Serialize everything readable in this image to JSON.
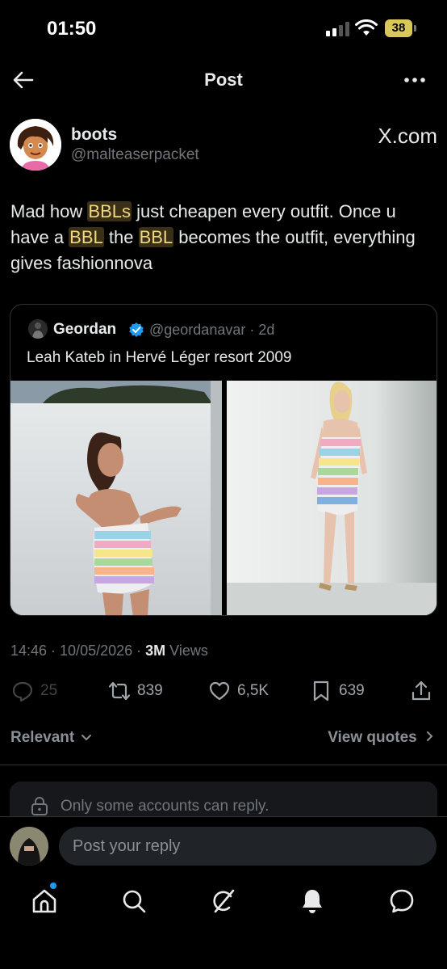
{
  "status": {
    "time": "01:50",
    "battery": "38"
  },
  "nav": {
    "title": "Post"
  },
  "author": {
    "name": "boots",
    "handle": "@malteaserpacket",
    "source": "X.com"
  },
  "tweet": {
    "p1": "Mad how ",
    "h1": "BBLs",
    "p2": " just cheapen every outfit. Once u have a ",
    "h2": "BBL",
    "p3": " the ",
    "h3": "BBL",
    "p4": " becomes the outfit, everything gives fashionnova"
  },
  "quote": {
    "name": "Geordan",
    "handle_time": "@geordanavar · 2d",
    "text": "Leah Kateb in Hervé Léger resort 2009"
  },
  "meta": {
    "time_date": "14:46 · 10/05/2026 · ",
    "views_count": "3M",
    "views_label": " Views"
  },
  "actions": {
    "replies": "25",
    "reposts": "839",
    "likes": "6,5K",
    "bookmarks": "639"
  },
  "filters": {
    "sort": "Relevant",
    "view_quotes": "View quotes"
  },
  "limited": {
    "text": "Only some accounts can reply."
  },
  "composer": {
    "placeholder": "Post your reply"
  },
  "colors": {
    "accent": "#1d9bf0",
    "highlight_bg": "#3a3016",
    "highlight_fg": "#f0d780",
    "muted": "#71767b"
  }
}
